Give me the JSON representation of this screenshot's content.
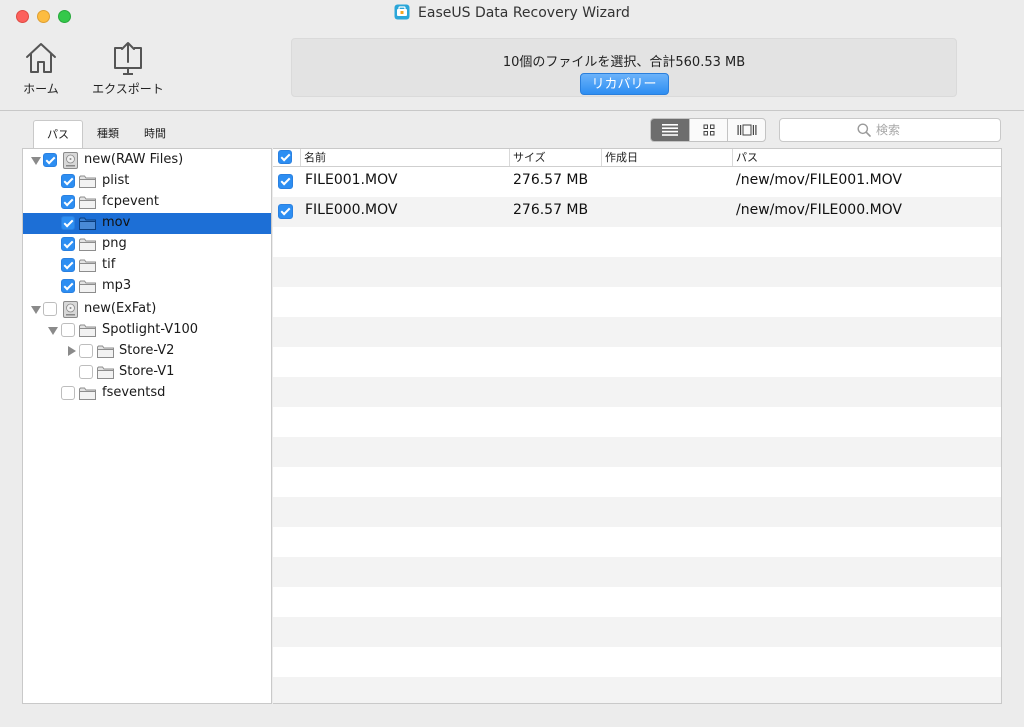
{
  "window": {
    "title": "EaseUS Data Recovery Wizard"
  },
  "toolbar": {
    "home_label": "ホーム",
    "export_label": "エクスポート"
  },
  "status": {
    "selection_text": "10個のファイルを選択、合計560.53 MB",
    "recover_label": "リカバリー"
  },
  "tabs": [
    {
      "label": "パス",
      "active": true
    },
    {
      "label": "種類",
      "active": false
    },
    {
      "label": "時間",
      "active": false
    }
  ],
  "view_modes": [
    "list-view-icon",
    "grid-view-icon",
    "filmstrip-view-icon"
  ],
  "search": {
    "placeholder": "検索",
    "value": ""
  },
  "tree": [
    {
      "label": "new(RAW Files)",
      "type": "drive",
      "checked": true,
      "disclosure": "expanded",
      "level": 0
    },
    {
      "label": "plist",
      "type": "folder",
      "checked": true,
      "level": 1
    },
    {
      "label": "fcpevent",
      "type": "folder",
      "checked": true,
      "level": 1
    },
    {
      "label": "mov",
      "type": "folder",
      "checked": true,
      "level": 1,
      "selected": true
    },
    {
      "label": "png",
      "type": "folder",
      "checked": true,
      "level": 1
    },
    {
      "label": "tif",
      "type": "folder",
      "checked": true,
      "level": 1
    },
    {
      "label": "mp3",
      "type": "folder",
      "checked": true,
      "level": 1
    },
    {
      "label": "new(ExFat)",
      "type": "drive",
      "checked": false,
      "disclosure": "expanded",
      "level": 0
    },
    {
      "label": "Spotlight-V100",
      "type": "folder",
      "checked": false,
      "disclosure": "expanded",
      "level": 1
    },
    {
      "label": "Store-V2",
      "type": "folder",
      "checked": false,
      "disclosure": "collapsed",
      "level": 2
    },
    {
      "label": "Store-V1",
      "type": "folder",
      "checked": false,
      "level": 2
    },
    {
      "label": "fseventsd",
      "type": "folder",
      "checked": false,
      "level": 1
    }
  ],
  "file_list": {
    "select_all_checked": true,
    "columns": [
      "名前",
      "サイズ",
      "作成日",
      "パス"
    ],
    "rows": [
      {
        "checked": true,
        "name": "FILE001.MOV",
        "size": "276.57 MB",
        "created": "",
        "path": "/new/mov/FILE001.MOV"
      },
      {
        "checked": true,
        "name": "FILE000.MOV",
        "size": "276.57 MB",
        "created": "",
        "path": "/new/mov/FILE000.MOV"
      }
    ]
  },
  "colors": {
    "accent": "#2d8ef2",
    "selection": "#1d6fd6",
    "traffic_red": "#fc605c",
    "traffic_yellow": "#fdbc40",
    "traffic_green": "#34c84a"
  }
}
